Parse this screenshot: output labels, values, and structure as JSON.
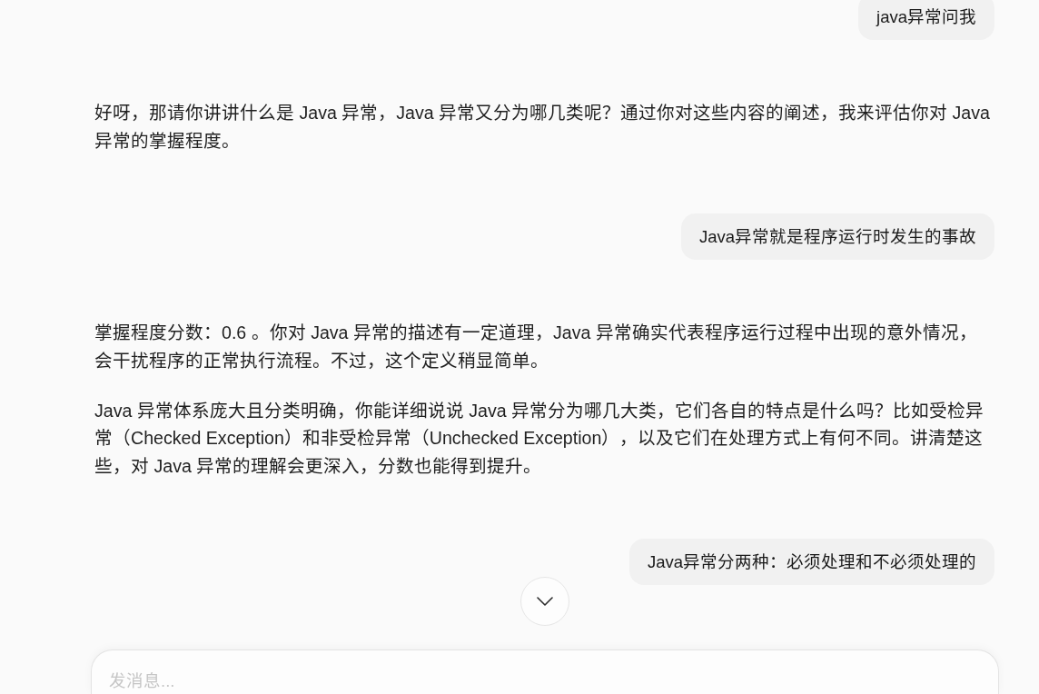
{
  "messages": [
    {
      "kind": "user",
      "text": "java异常问我"
    },
    {
      "kind": "assistant",
      "paragraphs": [
        "好呀，那请你讲讲什么是 Java 异常，Java 异常又分为哪几类呢？通过你对这些内容的阐述，我来评估你对 Java 异常的掌握程度。"
      ]
    },
    {
      "kind": "user",
      "text": "Java异常就是程序运行时发生的事故"
    },
    {
      "kind": "assistant",
      "paragraphs": [
        "掌握程度分数：0.6 。你对 Java 异常的描述有一定道理，Java 异常确实代表程序运行过程中出现的意外情况，会干扰程序的正常执行流程。不过，这个定义稍显简单。",
        "Java 异常体系庞大且分类明确，你能详细说说 Java 异常分为哪几大类，它们各自的特点是什么吗？比如受检异常（Checked Exception）和非受检异常（Unchecked Exception），以及它们在处理方式上有何不同。讲清楚这些，对 Java 异常的理解会更深入，分数也能得到提升。"
      ]
    },
    {
      "kind": "user",
      "text": "Java异常分两种：必须处理和不必须处理的"
    }
  ],
  "composer": {
    "placeholder": "发消息..."
  }
}
